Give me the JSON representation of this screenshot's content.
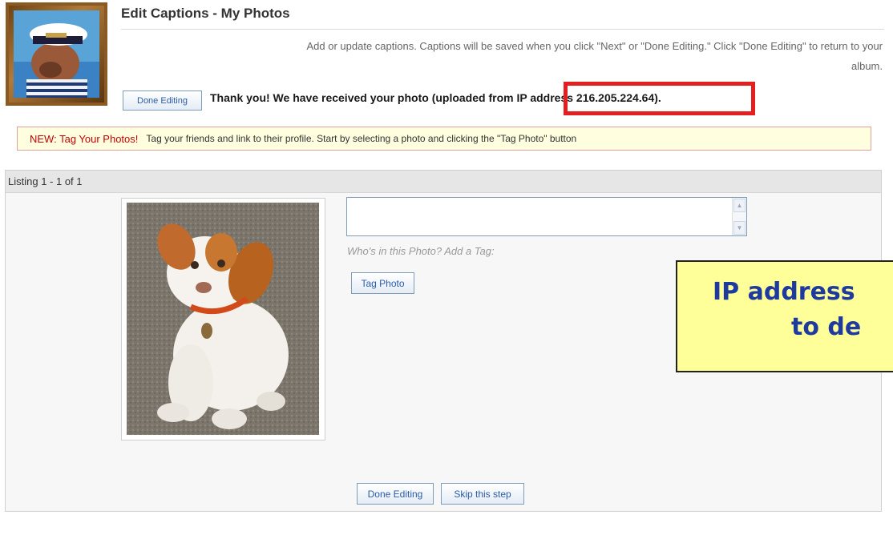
{
  "header": {
    "title": "Edit Captions - My Photos",
    "intro_line1": "Add or update captions. Captions will be saved when you click \"Next\" or \"Done Editing.\" Click \"Done Editing\" to return to your",
    "intro_line2": "album.",
    "done_editing_label": "Done Editing",
    "thanks_prefix": "Thank you! We have received your photo (uploaded from ",
    "thanks_ip": "IP address 216.205.224.64).",
    "highlight_color": "#e31f1f"
  },
  "notice": {
    "title": "NEW: Tag Your Photos!",
    "text": "Tag your friends and link to their profile. Start by selecting a photo and clicking the \"Tag Photo\" button"
  },
  "listing": {
    "header": "Listing 1 - 1 of 1",
    "caption_value": "",
    "tag_hint": "Who's in this Photo? Add a Tag:",
    "tag_button_label": "Tag Photo",
    "done_editing_label": "Done Editing",
    "skip_label": "Skip this step"
  },
  "callout": {
    "line1": "IP address",
    "line2": "to de",
    "background": "#ffff99",
    "text_color": "#1f3a9e"
  }
}
